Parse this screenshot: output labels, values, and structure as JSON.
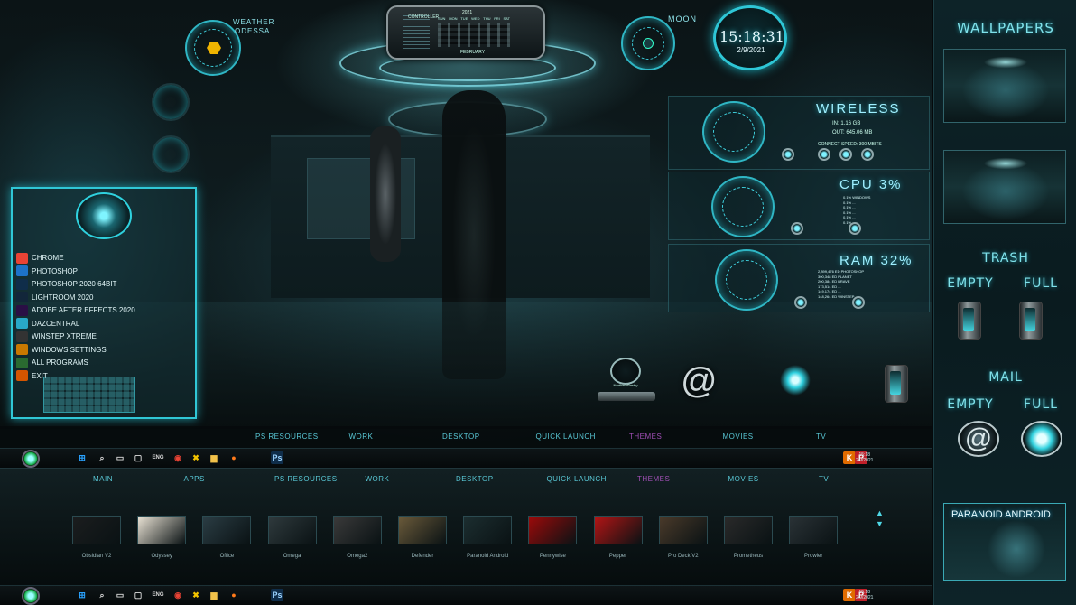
{
  "weather": {
    "label": "WEATHER",
    "location": "ODESSA"
  },
  "calendar": {
    "year": "2021",
    "days": [
      "SUN",
      "MON",
      "TUE",
      "WED",
      "THU",
      "FRI",
      "SAT"
    ],
    "month": "FEBRUARY",
    "title": "CONTROLLER"
  },
  "moon": {
    "label": "MOON"
  },
  "clock": {
    "time": "15:18:31",
    "date": "2/9/2021"
  },
  "wireless": {
    "title": "WIRELESS",
    "in": "IN: 1.16 GB",
    "out": "OUT: 645.06 MB",
    "speed": "CONNECT SPEED: 300 MBITS"
  },
  "cpu": {
    "title": "CPU 3%",
    "lines": [
      "0.1% WINDOWS",
      "0.1% ...",
      "0.1% ...",
      "0.1% ...",
      "0.1% ...",
      "0.1% ..."
    ]
  },
  "ram": {
    "title": "RAM 32%",
    "lines": [
      "2,899,476 ED PHOTOSHOP",
      "300,348 ED PLANET",
      "200,384 ED BRAVE",
      "173,514 ED ...",
      "149,174 ED ...",
      "148,264 ED WINSTEP"
    ]
  },
  "start_menu": {
    "items": [
      {
        "label": "CHROME",
        "icon": "chrome-icon",
        "color": "#e94335"
      },
      {
        "label": "PHOTOSHOP",
        "icon": "photoshop-icon",
        "color": "#1d72c8"
      },
      {
        "label": "PHOTOSHOP 2020 64BIT",
        "icon": "photoshop-icon",
        "color": "#0f2d4a"
      },
      {
        "label": "LIGHTROOM 2020",
        "icon": "lightroom-icon",
        "color": "#12263a"
      },
      {
        "label": "ADOBE AFTER EFFECTS 2020",
        "icon": "after-effects-icon",
        "color": "#2a0f45"
      },
      {
        "label": "DAZCENTRAL",
        "icon": "dazcentral-icon",
        "color": "#29a7c7"
      },
      {
        "label": "WINSTEP XTREME",
        "icon": "winstep-icon",
        "color": "#333"
      },
      {
        "label": "WINDOWS SETTINGS",
        "icon": "gear-icon",
        "color": "#c97800"
      },
      {
        "label": "ALL PROGRAMS",
        "icon": "programs-icon",
        "color": "#2a6a30"
      },
      {
        "label": "EXIT",
        "icon": "exit-icon",
        "color": "#d45500"
      }
    ]
  },
  "tabs_top": [
    "PS RESOURCES",
    "WORK",
    "DESKTOP",
    "QUICK LAUNCH",
    "THEMES",
    "MOVIES",
    "TV"
  ],
  "tabs_bottom": [
    "MAIN",
    "APPS",
    "PS RESOURCES",
    "WORK",
    "DESKTOP",
    "QUICK LAUNCH",
    "THEMES",
    "MOVIES",
    "TV"
  ],
  "active_tab": "THEMES",
  "taskbar": {
    "lang": "ENG",
    "ps": "Ps",
    "time": "15:18",
    "date": "2/9/2021"
  },
  "themes": [
    "Obsidian V2",
    "Odyssey",
    "Office",
    "Omega",
    "Omega2",
    "Defender",
    "Paranoid Android",
    "Pennywise",
    "Pepper",
    "Pro Deck V2",
    "Prometheus",
    "Prowler"
  ],
  "sidebar": {
    "wallpapers": "WALLPAPERS",
    "trash": "TRASH",
    "empty": "EMPTY",
    "full": "FULL",
    "mail": "MAIL",
    "preview_caption": "PARANOID ANDROID"
  },
  "desktop_icon": {
    "label": "NorthernPastry"
  }
}
